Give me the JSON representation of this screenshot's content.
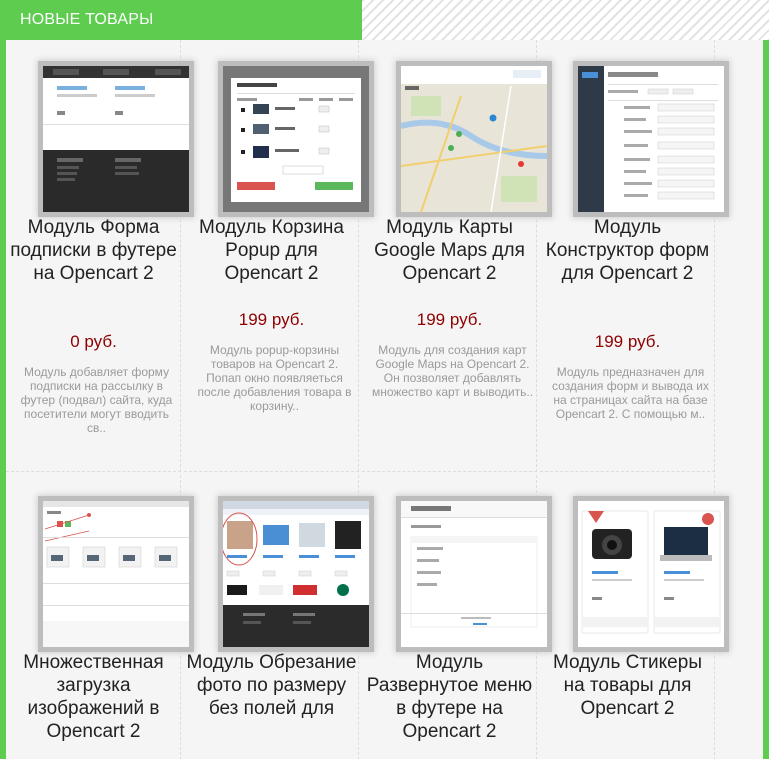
{
  "header": {
    "title": "НОВЫЕ ТОВАРЫ"
  },
  "products": [
    {
      "thumbnail": "subscribe-form-footer-screenshot",
      "title": "Модуль Форма подписки в футере на Opencart 2",
      "price": "0 руб.",
      "description": "Модуль добавляет форму подписки на рассылку в футер (подвал) сайта, куда посетители могут вводить св.."
    },
    {
      "thumbnail": "cart-popup-screenshot",
      "title": "Модуль Корзина Popup для Opencart 2",
      "price": "199 руб.",
      "description": "Модуль popup-корзины товаров на Opencart 2. Попап окно появляеться после добавления товара в корзину.."
    },
    {
      "thumbnail": "google-maps-screenshot",
      "title": "Модуль Карты Google Maps для Opencart 2",
      "price": "199 руб.",
      "description": "Модуль для создания карт Google Maps на Opencart 2. Он позволяет добавлять множество карт и выводить.."
    },
    {
      "thumbnail": "form-builder-screenshot",
      "title": "Модуль Конструктор форм для Opencart 2",
      "price": "199 руб.",
      "description": "Модуль предназначен для создания форм и вывода их на страницах сайта на базе Opencart 2. С помощью м.."
    },
    {
      "thumbnail": "multi-upload-screenshot",
      "title": "Множественная загрузка изображений в Opencart 2",
      "price": "",
      "description": ""
    },
    {
      "thumbnail": "crop-photo-screenshot",
      "title": "Модуль Обрезание фото по размеру без полей для",
      "price": "",
      "description": ""
    },
    {
      "thumbnail": "footer-menu-screenshot",
      "title": "Модуль Развернутое меню в футере на Opencart 2",
      "price": "",
      "description": ""
    },
    {
      "thumbnail": "stickers-screenshot",
      "title": "Модуль Стикеры на товары для Opencart 2",
      "price": "",
      "description": ""
    }
  ],
  "colors": {
    "brand_green": "#5dcc4f",
    "price_red": "#8e0000",
    "desc_gray": "#9a9a9a"
  }
}
